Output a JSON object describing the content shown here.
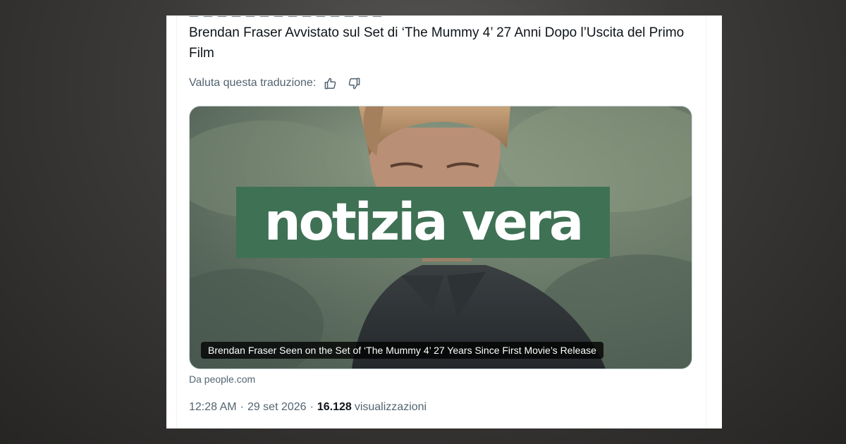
{
  "post": {
    "headline": "Brendan Fraser Avvistato sul Set di ‘The Mummy 4’ 27 Anni Dopo l’Uscita del Primo Film",
    "rate_translation_label": "Valuta questa traduzione:",
    "link_card": {
      "caption": "Brendan Fraser Seen on the Set of ‘The Mummy 4’ 27 Years Since First Movie’s Release",
      "source": "Da people.com"
    },
    "time": "12:28 AM",
    "separator": "·",
    "date": "29 set 2026",
    "views_count": "16.128",
    "views_label": "visualizzazioni"
  },
  "overlay": {
    "label": "notizia vera",
    "color": "#3f7154"
  },
  "icons": {
    "thumbs_up": "thumbs-up-icon",
    "thumbs_down": "thumbs-down-icon"
  }
}
